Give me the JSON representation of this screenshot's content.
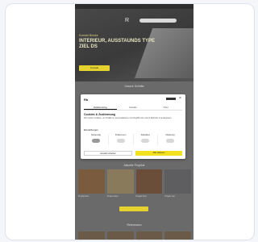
{
  "site": {
    "logo": "R",
    "hero_kicker": "Kontakt Brücke",
    "hero_title": "INTERIEUR, AUSSTAUNDS TYPE ZIEL DS",
    "hero_button": "Kontakt",
    "section_heading": "Unsere Schritte",
    "gallery_heading": "Aktuelle Projekte",
    "gallery_captions": [
      "Projekt Eins",
      "Projekt Zwei",
      "Projekt Drei",
      "Projekt Vier"
    ],
    "bottom_heading": "Referenzen"
  },
  "consent": {
    "logo": "Rb",
    "tabs": [
      "Zustimmung",
      "Details",
      "Über"
    ],
    "title": "Cookies & Zustimmung",
    "text": "Wir nutzen Cookies, um Inhalte zu personalisieren und Zugriffe auf unsere Website zu analysieren.",
    "details_label": "Einstellungen",
    "toggles": [
      {
        "label": "Notwendig",
        "on": true
      },
      {
        "label": "Präferenzen",
        "on": false
      },
      {
        "label": "Statistiken",
        "on": false
      },
      {
        "label": "Marketing",
        "on": false
      }
    ],
    "reject_label": "Auswahl erlauben",
    "accept_label": "Alle zulassen"
  },
  "colors": {
    "accent": "#e6d22e",
    "overlay": "#6a6a6a"
  }
}
